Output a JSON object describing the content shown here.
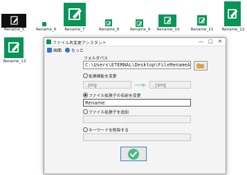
{
  "desktop": {
    "icons": [
      {
        "label": "Rename_5"
      },
      {
        "label": "Rename_6"
      },
      {
        "label": "Rename_7"
      },
      {
        "label": "Rename_8"
      },
      {
        "label": "Rename_9"
      },
      {
        "label": "Rename_10"
      },
      {
        "label": "Rename_11"
      },
      {
        "label": "Rename_12"
      },
      {
        "label": "Rename_13"
      }
    ]
  },
  "dialog": {
    "title": "ファイル名変更アシスタント",
    "window_buttons": {
      "minimize": "—",
      "maximize": "□",
      "close": "✕"
    },
    "menu": {
      "home": "画面",
      "about": "もっと"
    },
    "folder_label": "フォルダパス",
    "folder_path": "C:\\Users\\ETERNAL\\Desktop\\FileRenameAssis",
    "options": {
      "change_ext": "拡張機能を変更",
      "change_name": "ファイル拡張子の名前を変更",
      "add_ext": "ファイル拡張子を追加",
      "keyword_delete": "キーワードを削除する"
    },
    "ext_from_placeholder": ".png",
    "ext_to_placeholder": ".jpeg",
    "name_value": "Rename"
  },
  "colors": {
    "accent": "#0a9457",
    "ok": "#4cbb87"
  }
}
